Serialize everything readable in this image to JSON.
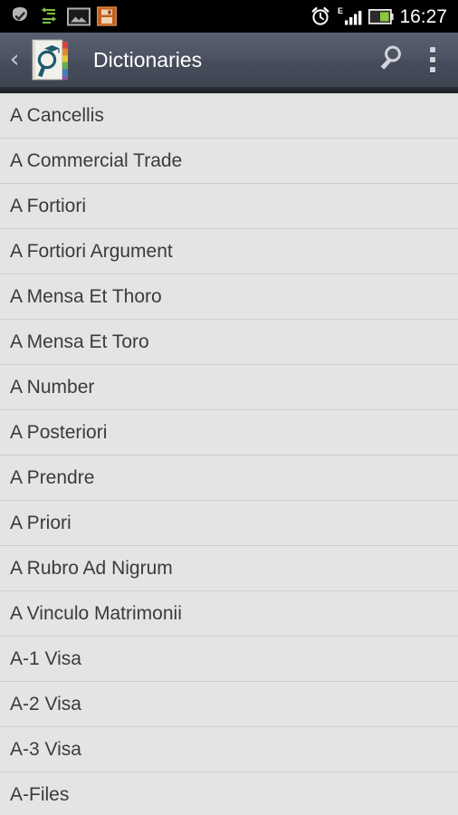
{
  "status_bar": {
    "background": "#000000",
    "clock": "16:27",
    "left_icons": [
      {
        "name": "check-badge-icon",
        "color": "#b4b4b4"
      },
      {
        "name": "sync-transfer-icon",
        "color": "#7bc043"
      },
      {
        "name": "gallery-image-icon",
        "color": "#b0b0b0"
      },
      {
        "name": "save-floppy-icon",
        "color": "#c46a2a"
      }
    ],
    "right_icons": [
      {
        "name": "alarm-clock-icon",
        "color": "#ffffff"
      },
      {
        "name": "signal-bars-icon",
        "color": "#ffffff",
        "network": "E"
      },
      {
        "name": "battery-icon",
        "color": "#8cc63f"
      }
    ]
  },
  "action_bar": {
    "background": "#4c5262",
    "back_label": "‹",
    "app_icon_name": "dictionary-book-icon",
    "title": "Dictionaries",
    "search_icon_name": "search-icon",
    "overflow_icon_name": "overflow-menu-icon",
    "title_color": "#ffffff"
  },
  "list": {
    "background": "#e4e4e4",
    "text_color": "#3b3b3b",
    "divider_color": "#cdcdcd",
    "items": [
      {
        "label": "A Cancellis"
      },
      {
        "label": "A Commercial Trade"
      },
      {
        "label": "A Fortiori"
      },
      {
        "label": "A Fortiori Argument"
      },
      {
        "label": "A Mensa Et Thoro"
      },
      {
        "label": "A Mensa Et Toro"
      },
      {
        "label": "A Number"
      },
      {
        "label": "A Posteriori"
      },
      {
        "label": "A Prendre"
      },
      {
        "label": "A Priori"
      },
      {
        "label": "A Rubro Ad Nigrum"
      },
      {
        "label": "A Vinculo Matrimonii"
      },
      {
        "label": "A-1 Visa"
      },
      {
        "label": "A-2 Visa"
      },
      {
        "label": "A-3 Visa"
      },
      {
        "label": "A-Files"
      }
    ]
  }
}
